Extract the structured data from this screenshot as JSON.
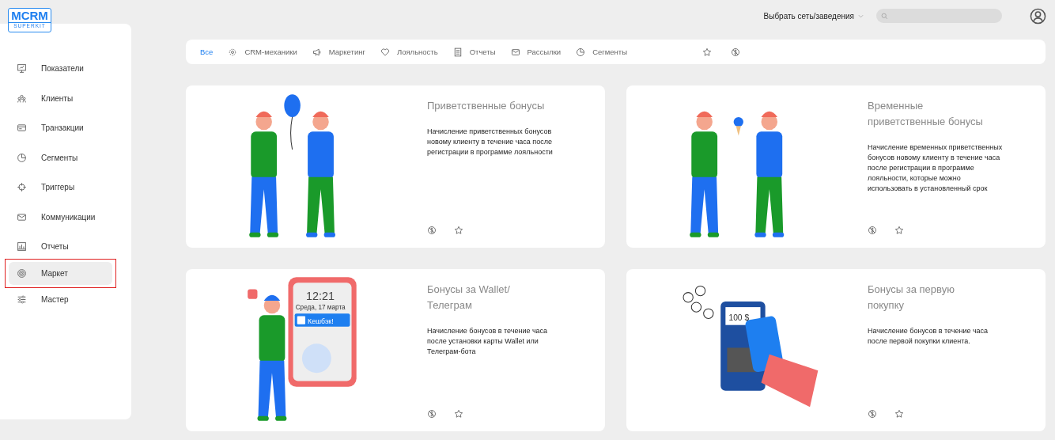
{
  "logo": {
    "title": "MCRM",
    "subtitle": "SUPERKIT"
  },
  "header": {
    "venue_selector": "Выбрать сеть/заведения"
  },
  "sidebar": {
    "items": [
      {
        "label": "Показатели",
        "selected": false,
        "highlighted": false
      },
      {
        "label": "Клиенты",
        "selected": false,
        "highlighted": false
      },
      {
        "label": "Транзакции",
        "selected": false,
        "highlighted": false
      },
      {
        "label": "Сегменты",
        "selected": false,
        "highlighted": false
      },
      {
        "label": "Триггеры",
        "selected": false,
        "highlighted": false
      },
      {
        "label": "Коммуникации",
        "selected": false,
        "highlighted": false
      },
      {
        "label": "Отчеты",
        "selected": false,
        "highlighted": false
      },
      {
        "label": "Маркет",
        "selected": true,
        "highlighted": true
      },
      {
        "label": "Мастер",
        "selected": false,
        "highlighted": false
      }
    ]
  },
  "filters": {
    "tabs": [
      {
        "label": "Все",
        "selected": true
      },
      {
        "label": "CRM-механики",
        "selected": false
      },
      {
        "label": "Маркетинг",
        "selected": false
      },
      {
        "label": "Лояльность",
        "selected": false
      },
      {
        "label": "Отчеты",
        "selected": false
      },
      {
        "label": "Рассылки",
        "selected": false
      },
      {
        "label": "Сегменты",
        "selected": false
      }
    ]
  },
  "cards": [
    {
      "title": "Приветственные бонусы",
      "description": "Начисление приветственных бонусов новому клиенту в течение часа после регистрации в программе лояльности",
      "kind": "balloon"
    },
    {
      "title": "Временные приветственные бонусы",
      "description": "Начисление временных приветственных бонусов новому клиенту в течение часа после регистрации в программе лояльности, которые можно использовать в установленный срок",
      "kind": "icecream"
    },
    {
      "title": "Бонусы за Wallet/ Телеграм",
      "description": "Начисление бонусов в течение часа после установки карты Wallet или Телеграм-бота",
      "kind": "phone",
      "screen_texts": [
        "12:21",
        "Среда, 17 марта",
        "Кешбэк!"
      ]
    },
    {
      "title": "Бонусы за первую покупку",
      "description": "Начисление бонусов в течение часа после первой покупки клиента.",
      "kind": "terminal",
      "screen_texts": [
        "100 $"
      ]
    }
  ]
}
